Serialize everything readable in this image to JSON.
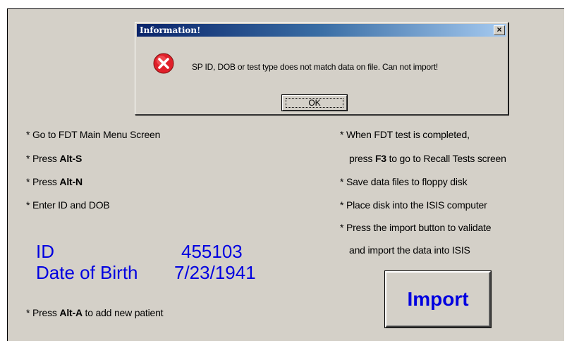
{
  "dialog": {
    "title": "Information!",
    "close_label": "x",
    "message": "SP ID, DOB or test type does not match data on file. Can not import!",
    "ok_label": "OK",
    "icon": "error-icon"
  },
  "left_instructions": [
    {
      "prefix": "* Go to FDT Main Menu Screen",
      "bold": "",
      "suffix": ""
    },
    {
      "prefix": "* Press ",
      "bold": "Alt-S",
      "suffix": ""
    },
    {
      "prefix": "* Press ",
      "bold": "Alt-N",
      "suffix": ""
    },
    {
      "prefix": "* Enter ID and DOB",
      "bold": "",
      "suffix": ""
    }
  ],
  "right_instructions": [
    {
      "prefix": "* When FDT test is completed,",
      "bold": "",
      "suffix": ""
    },
    {
      "prefix": "press ",
      "bold": "F3",
      "suffix": " to go to Recall Tests screen"
    },
    {
      "prefix": "* Save data files to floppy disk",
      "bold": "",
      "suffix": ""
    },
    {
      "prefix": "* Place disk into the ISIS computer",
      "bold": "",
      "suffix": ""
    },
    {
      "prefix": "* Press the import button to validate",
      "bold": "",
      "suffix": ""
    },
    {
      "prefix": "and import the data into ISIS",
      "bold": "",
      "suffix": ""
    }
  ],
  "patient": {
    "id_label": "ID",
    "id_value": "455103",
    "dob_label": "Date of Birth",
    "dob_value": "7/23/1941"
  },
  "add_patient": {
    "prefix": "* Press ",
    "bold": "Alt-A",
    "suffix": " to add new patient"
  },
  "import_label": "Import",
  "colors": {
    "accent": "#0000e0",
    "window_bg": "#d4d0c8"
  }
}
